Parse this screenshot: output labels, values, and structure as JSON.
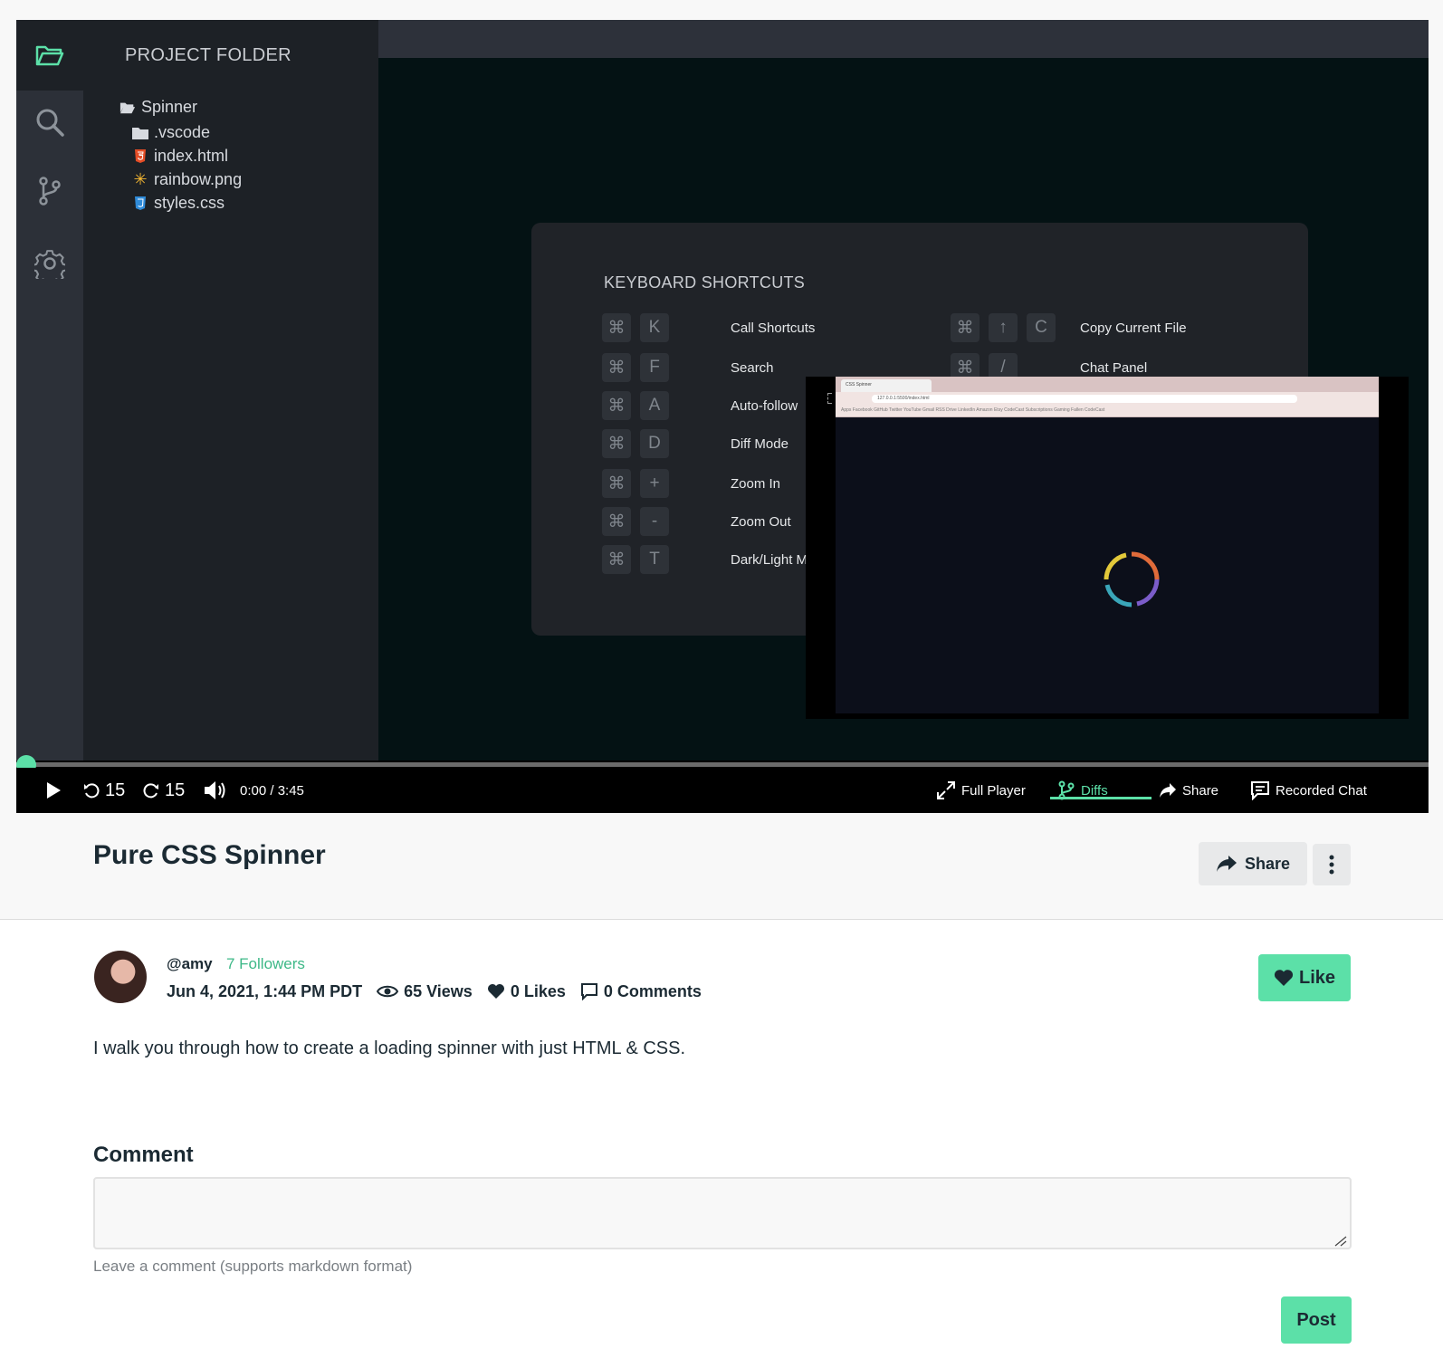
{
  "ide": {
    "explorer_title": "PROJECT FOLDER",
    "files": [
      {
        "name": "Spinner",
        "icon": "folder-open-icon"
      },
      {
        "name": ".vscode",
        "icon": "folder-icon"
      },
      {
        "name": "index.html",
        "icon": "html-file-icon"
      },
      {
        "name": "rainbow.png",
        "icon": "image-file-icon"
      },
      {
        "name": "styles.css",
        "icon": "css-file-icon"
      }
    ],
    "activity_icons": [
      "folder-icon",
      "search-icon",
      "source-control-icon",
      "gear-icon"
    ]
  },
  "shortcuts": {
    "title": "KEYBOARD SHORTCUTS",
    "left": [
      {
        "keys": [
          "⌘",
          "K"
        ],
        "label": "Call Shortcuts"
      },
      {
        "keys": [
          "⌘",
          "F"
        ],
        "label": "Search"
      },
      {
        "keys": [
          "⌘",
          "A"
        ],
        "label": "Auto-follow"
      },
      {
        "keys": [
          "⌘",
          "D"
        ],
        "label": "Diff Mode"
      },
      {
        "keys": [
          "⌘",
          "+"
        ],
        "label": "Zoom In"
      },
      {
        "keys": [
          "⌘",
          "-"
        ],
        "label": "Zoom Out"
      },
      {
        "keys": [
          "⌘",
          "T"
        ],
        "label": "Dark/Light Mo"
      }
    ],
    "right": [
      {
        "keys": [
          "⌘",
          "↑",
          "C"
        ],
        "label": "Copy Current File"
      },
      {
        "keys": [
          "⌘",
          "/"
        ],
        "label": "Chat Panel"
      }
    ]
  },
  "browser": {
    "tab_title": "CSS Spinner",
    "url": "127.0.0.1:5500/index.html",
    "bookmarks": "Apps  Facebook  GitHub  Twitter  YouTube  Gmail  RSS  Drive  LinkedIn  Amazon  Etsy  CodeCast  Subscriptions  Gaming  Fallen  CodeCast"
  },
  "player": {
    "progress": 0,
    "rewind_label": "15",
    "forward_label": "15",
    "time": "0:00 / 3:45",
    "full_player": "Full Player",
    "diffs": "Diffs",
    "share": "Share",
    "recorded_chat": "Recorded Chat"
  },
  "video": {
    "title": "Pure CSS Spinner",
    "share_label": "Share",
    "author_handle": "@amy",
    "followers": "7 Followers",
    "date": "Jun 4, 2021, 1:44 PM PDT",
    "views": "65 Views",
    "likes": "0 Likes",
    "comments": "0 Comments",
    "like_label": "Like",
    "description": "I walk you through how to create a loading spinner with just HTML & CSS."
  },
  "comment": {
    "heading": "Comment",
    "value": "",
    "hint": "Leave a comment (supports markdown format)",
    "post_label": "Post"
  },
  "colors": {
    "accent": "#5ce0a8",
    "accent_text": "#3db887",
    "ide_bg": "#1d2126",
    "editor_bg": "#041214"
  }
}
